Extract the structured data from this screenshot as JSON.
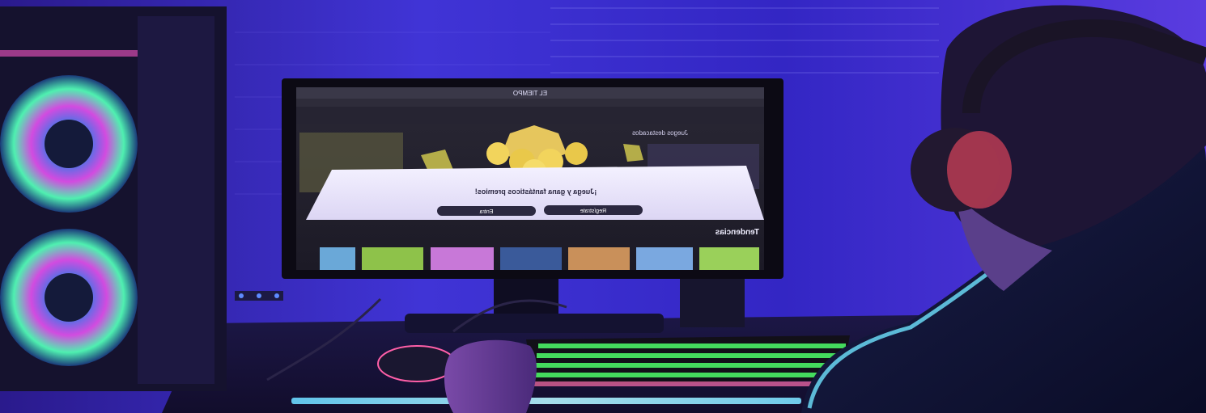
{
  "scene": {
    "description_free": true
  },
  "monitor": {
    "brand_bar": "EL TIEMPO",
    "section_heading": "Juegos destacados",
    "promo_text": "¡Juega y gana fantásticos premios!",
    "register_label": "Regístrate",
    "login_label": "Entra",
    "trending_heading": "Tendencias"
  },
  "colors": {
    "wall": "#3a2fd0",
    "ambient_pink": "#d23cd6",
    "desk_glow": "#3cf0ff",
    "keyboard_green": "#4dff6a",
    "screen_bg": "#23202d"
  }
}
